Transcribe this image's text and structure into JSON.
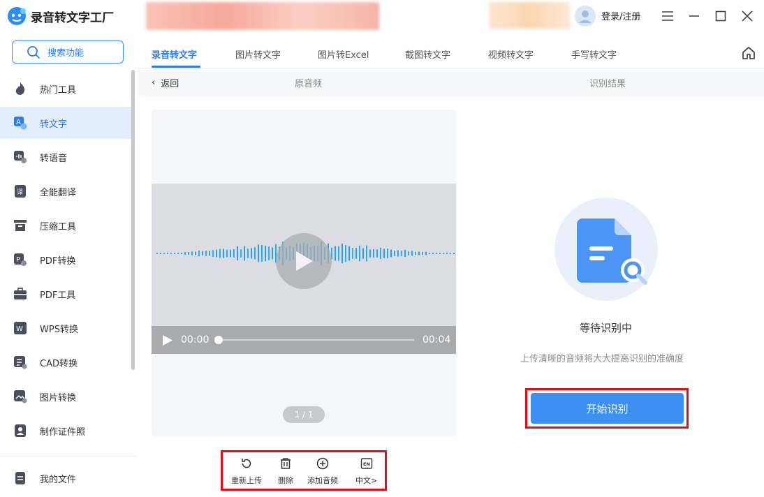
{
  "app": {
    "title": "录音转文字工厂",
    "login": "登录/注册"
  },
  "sidebar": {
    "search_label": "搜索功能",
    "items": [
      {
        "label": "热门工具",
        "icon": "flame-icon"
      },
      {
        "label": "转文字",
        "icon": "text-convert-icon",
        "active": true
      },
      {
        "label": "转语音",
        "icon": "voice-icon"
      },
      {
        "label": "全能翻译",
        "icon": "translate-icon"
      },
      {
        "label": "压缩工具",
        "icon": "compress-icon"
      },
      {
        "label": "PDF转换",
        "icon": "pdf-convert-icon"
      },
      {
        "label": "PDF工具",
        "icon": "toolbox-icon"
      },
      {
        "label": "WPS转换",
        "icon": "wps-icon"
      },
      {
        "label": "CAD转换",
        "icon": "cad-icon"
      },
      {
        "label": "图片转换",
        "icon": "image-icon"
      },
      {
        "label": "制作证件照",
        "icon": "id-photo-icon"
      }
    ],
    "my_files": "我的文件"
  },
  "tabs": [
    "录音转文字",
    "图片转文字",
    "图片转Excel",
    "截图转文字",
    "视频转文字",
    "手写转文字"
  ],
  "subbar": {
    "back": "返回",
    "original": "原音频",
    "result": "识别结果"
  },
  "player": {
    "current": "00:00",
    "duration": "00:04",
    "pager": "1 / 1",
    "progress": 0
  },
  "toolbar": {
    "reupload": "重新上传",
    "delete": "删除",
    "add_audio": "添加音频",
    "language": "中文>"
  },
  "result": {
    "status": "等待识别中",
    "hint": "上传清晰的音频将大大提高识别的准确度",
    "start_button": "开始识别"
  },
  "colors": {
    "accent": "#2f7de1",
    "button": "#3d8ff1",
    "highlight": "#e20e17"
  }
}
